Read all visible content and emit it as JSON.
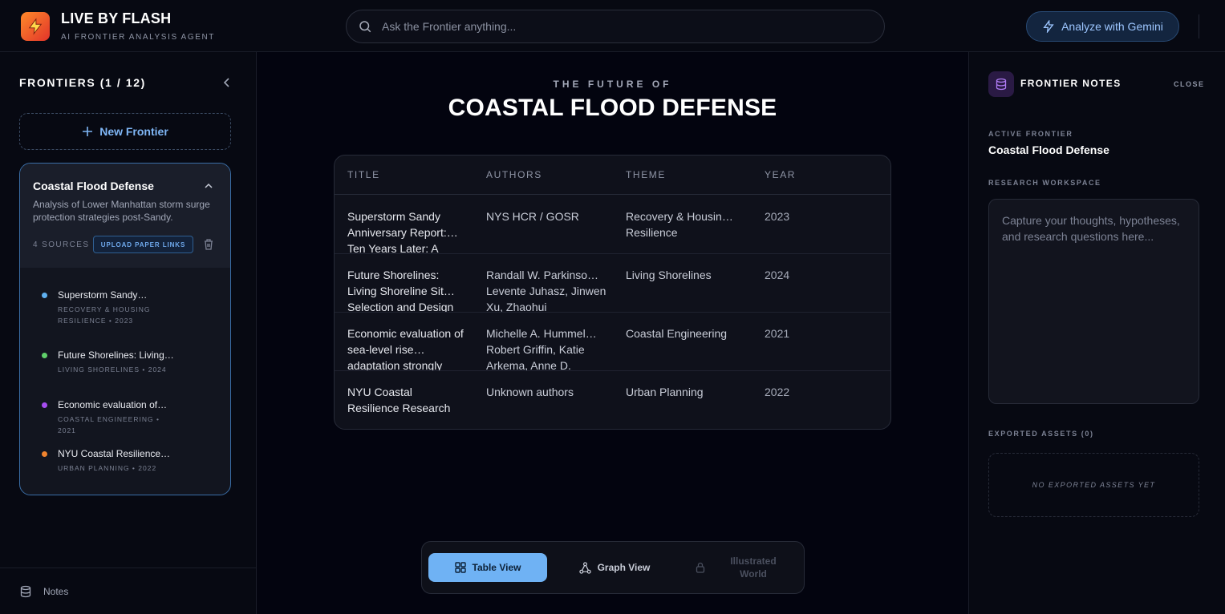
{
  "header": {
    "brand_title": "LIVE BY FLASH",
    "brand_subtitle": "AI FRONTIER ANALYSIS AGENT",
    "search_placeholder": "Ask the Frontier anything...",
    "analyze_label": "Analyze with Gemini"
  },
  "sidebar": {
    "title": "FRONTIERS (1 / 12)",
    "new_frontier_label": "New Frontier",
    "card": {
      "title": "Coastal Flood Defense",
      "description": "Analysis of Lower Manhattan storm surge protection strategies post-Sandy.",
      "sources_label": "4 SOURCES",
      "upload_label": "UPLOAD PAPER LINKS",
      "items": [
        {
          "title": "Superstorm Sandy…",
          "meta": "RECOVERY & HOUSING RESILIENCE • 2023",
          "color": "#5fb0f0"
        },
        {
          "title": "Future Shorelines: Living…",
          "meta": "LIVING SHORELINES • 2024",
          "color": "#5fd06a"
        },
        {
          "title": "Economic evaluation of…",
          "meta": "COASTAL ENGINEERING • 2021",
          "color": "#a64df0"
        },
        {
          "title": "NYU Coastal Resilience…",
          "meta": "URBAN PLANNING • 2022",
          "color": "#f0832e"
        }
      ]
    },
    "footer_notes_label": "Notes"
  },
  "main": {
    "eyebrow": "THE FUTURE OF",
    "title": "COASTAL FLOOD DEFENSE",
    "table": {
      "columns": [
        "TITLE",
        "AUTHORS",
        "THEME",
        "YEAR"
      ],
      "rows": [
        {
          "title": "Superstorm Sandy Anniversary Report:… Ten Years Later: A",
          "authors": "NYS HCR / GOSR",
          "theme": "Recovery & Housin… Resilience",
          "year": "2023"
        },
        {
          "title": "Future Shorelines: Living Shoreline Sit… Selection and Design",
          "authors": "Randall W. Parkinso… Levente Juhasz, Jinwen Xu, Zhaohui",
          "theme": "Living Shorelines",
          "year": "2024"
        },
        {
          "title": "Economic evaluation of sea-level rise… adaptation strongly",
          "authors": "Michelle A. Hummel… Robert Griffin, Katie Arkema, Anne D.",
          "theme": "Coastal Engineering",
          "year": "2021"
        },
        {
          "title": "NYU Coastal Resilience Research",
          "authors": "Unknown authors",
          "theme": "Urban Planning",
          "year": "2022"
        }
      ]
    },
    "views": {
      "table_label": "Table View",
      "graph_label": "Graph View",
      "world_label": "Illustrated World"
    }
  },
  "notes_panel": {
    "title": "FRONTIER NOTES",
    "close_label": "CLOSE",
    "active_label": "ACTIVE FRONTIER",
    "active_value": "Coastal Flood Defense",
    "workspace_label": "RESEARCH WORKSPACE",
    "workspace_placeholder": "Capture your thoughts, hypotheses, and research questions here...",
    "assets_label": "EXPORTED ASSETS (0)",
    "assets_empty": "NO EXPORTED ASSETS YET"
  }
}
